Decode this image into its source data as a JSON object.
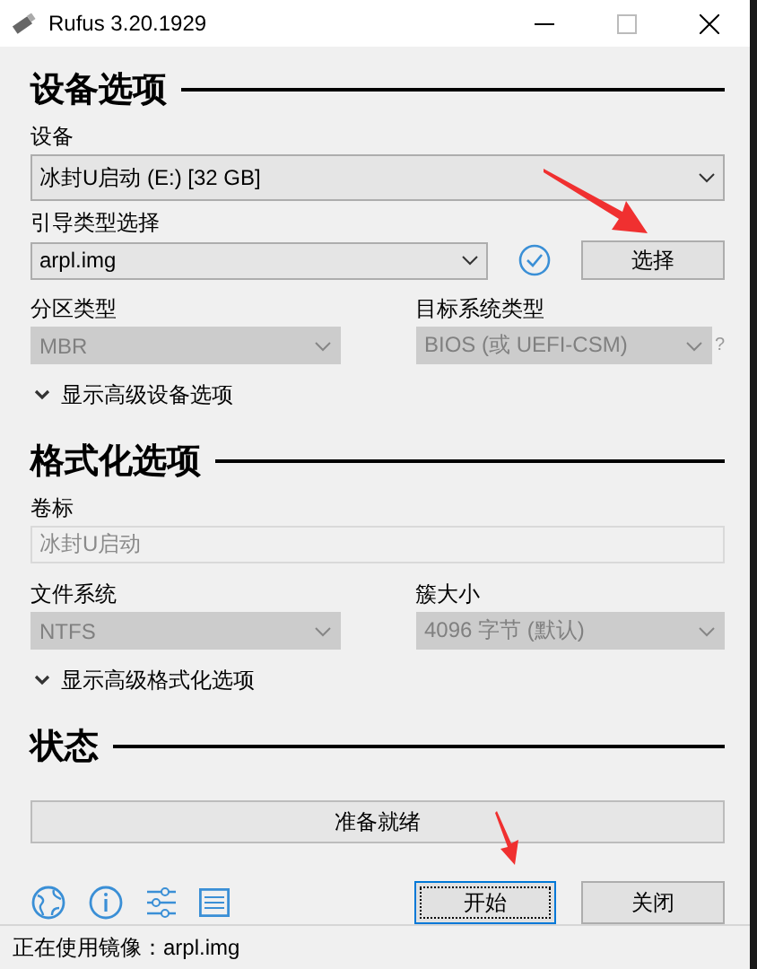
{
  "window": {
    "title": "Rufus 3.20.1929"
  },
  "sections": [
    {
      "heading": "设备选项",
      "rows": [
        {
          "kind": "full",
          "fields": [
            {
              "label": "设备",
              "kind": "select",
              "value": "冰封U启动 (E:) [32 GB]",
              "disabled": false
            }
          ]
        },
        {
          "kind": "boot",
          "fields": [
            {
              "label": "引导类型选择",
              "kind": "select",
              "value": "arpl.img",
              "disabled": false
            }
          ],
          "verified": true,
          "button": "选择"
        },
        {
          "kind": "half",
          "fields": [
            {
              "label": "分区类型",
              "kind": "select",
              "value": "MBR",
              "disabled": true
            },
            {
              "label": "目标系统类型",
              "kind": "select",
              "value": "BIOS (或 UEFI-CSM)",
              "disabled": true,
              "help": "?"
            }
          ]
        }
      ],
      "expander": {
        "label": "显示高级设备选项",
        "expanded": false
      }
    },
    {
      "heading": "格式化选项",
      "rows": [
        {
          "kind": "full",
          "fields": [
            {
              "label": "卷标",
              "kind": "text",
              "value": "冰封U启动",
              "disabled": true
            }
          ]
        },
        {
          "kind": "half",
          "fields": [
            {
              "label": "文件系统",
              "kind": "select",
              "value": "NTFS",
              "disabled": true
            },
            {
              "label": "簇大小",
              "kind": "select",
              "value": "4096 字节 (默认)",
              "disabled": true
            }
          ]
        }
      ],
      "expander": {
        "label": "显示高级格式化选项",
        "expanded": false
      }
    },
    {
      "heading": "状态",
      "status": {
        "text": "准备就绪"
      }
    }
  ],
  "buttons": [
    {
      "label": "开始",
      "focused": true
    },
    {
      "label": "关闭",
      "focused": false
    }
  ],
  "status_bar": "正在使用镜像：arpl.img"
}
